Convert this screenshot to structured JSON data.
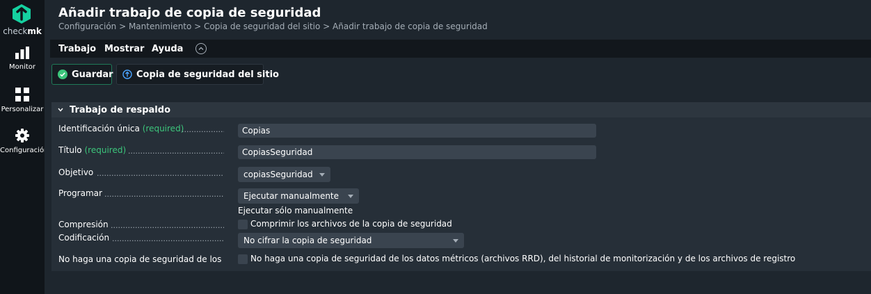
{
  "sidebar": {
    "logo_text_plain": "check",
    "logo_text_bold": "mk",
    "items": [
      {
        "label": "Monitor",
        "icon": "bar-chart-icon"
      },
      {
        "label": "Personalizar",
        "icon": "grid-icon"
      },
      {
        "label": "Configuración",
        "icon": "gear-icon"
      }
    ]
  },
  "header": {
    "title": "Añadir trabajo de copia de seguridad",
    "breadcrumb": "Configuración > Mantenimiento > Copia de seguridad del sitio > Añadir trabajo de copia de seguridad"
  },
  "menubar": {
    "items": [
      "Trabajo",
      "Mostrar",
      "Ayuda"
    ]
  },
  "toolbar": {
    "save_label": "Guardar",
    "site_backup_label": "Copia de seguridad del sitio"
  },
  "section": {
    "title": "Trabajo de respaldo",
    "required_tag": "(required)",
    "fields": {
      "id": {
        "label": "Identificación única",
        "value": "Copias"
      },
      "title": {
        "label": "Título",
        "value": "CopiasSeguridad"
      },
      "target": {
        "label": "Objetivo",
        "value": "copiasSeguridad"
      },
      "schedule": {
        "label": "Programar",
        "value": "Ejecutar manualmente",
        "note": "Ejecutar sólo manualmente"
      },
      "compression": {
        "label": "Compresión",
        "checkbox_label": "Comprimir los archivos de la copia de seguridad"
      },
      "encryption": {
        "label": "Codificación",
        "value": "No cifrar la copia de seguridad"
      },
      "no_history": {
        "label": "No haga una copia de seguridad de los d",
        "checkbox_label": "No haga una copia de seguridad de los datos métricos (archivos RRD), del historial de monitorización y de los archivos de registro"
      }
    }
  },
  "colors": {
    "accent": "#15d1a0",
    "required": "#3cc57b",
    "background": "#1e262e",
    "sidebar": "#10151a"
  }
}
